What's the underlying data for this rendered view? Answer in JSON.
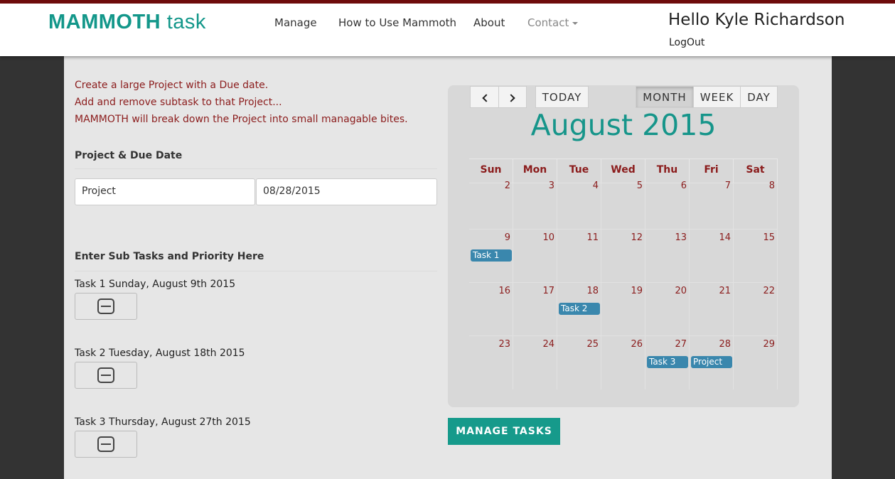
{
  "brand": {
    "bold": "MAMMOTH",
    "light": " task",
    "color": "#13978a"
  },
  "nav": {
    "items": [
      {
        "label": "Manage"
      },
      {
        "label": "How to Use Mammoth"
      },
      {
        "label": "About"
      },
      {
        "label": "Contact"
      }
    ]
  },
  "user": {
    "greeting": "Hello Kyle Richardson",
    "logout": "LogOut"
  },
  "intro": [
    "Create a large Project with a Due date.",
    "Add and remove subtask to that Project...",
    "MAMMOTH will break down the Project into small managable bites."
  ],
  "project": {
    "section_title": "Project & Due Date",
    "name_value": "Project",
    "due_value": "08/28/2015"
  },
  "subtasks": {
    "section_title": "Enter Sub Tasks and Priority Here",
    "items": [
      {
        "label": "Task 1 Sunday, August 9th 2015",
        "remove_icon": "minus-square-icon"
      },
      {
        "label": "Task 2 Tuesday, August 18th 2015",
        "remove_icon": "minus-square-icon"
      },
      {
        "label": "Task 3 Thursday, August 27th 2015",
        "remove_icon": "minus-square-icon"
      }
    ]
  },
  "calendar": {
    "prev_icon": "chevron-left-icon",
    "next_icon": "chevron-right-icon",
    "today": "TODAY",
    "views": [
      "MONTH",
      "WEEK",
      "DAY"
    ],
    "active_view": "MONTH",
    "title": "August 2015",
    "weekdays": [
      "Sun",
      "Mon",
      "Tue",
      "Wed",
      "Thu",
      "Fri",
      "Sat"
    ],
    "weeks": [
      [
        "2",
        "3",
        "4",
        "5",
        "6",
        "7",
        "8"
      ],
      [
        "9",
        "10",
        "11",
        "12",
        "13",
        "14",
        "15"
      ],
      [
        "16",
        "17",
        "18",
        "19",
        "20",
        "21",
        "22"
      ],
      [
        "23",
        "24",
        "25",
        "26",
        "27",
        "28",
        "29"
      ]
    ],
    "events": [
      {
        "label": "Task 1",
        "week": 1,
        "day": 0
      },
      {
        "label": "Task 2",
        "week": 2,
        "day": 2
      },
      {
        "label": "Task 3",
        "week": 3,
        "day": 4
      },
      {
        "label": "Project",
        "week": 3,
        "day": 5
      }
    ],
    "event_color": "#3a87ad"
  },
  "manage_button": "MANAGE TASKS"
}
